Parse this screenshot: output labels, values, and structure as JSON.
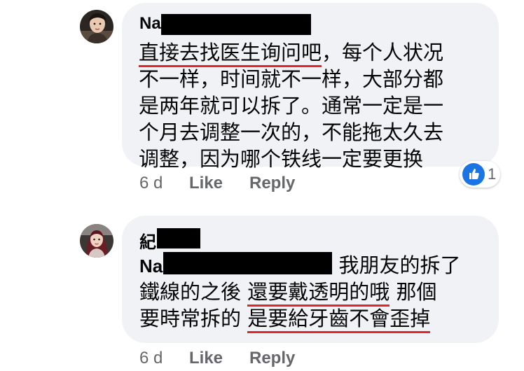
{
  "comments": [
    {
      "author_visible": "Na",
      "body_lines": [
        {
          "u": "直接去找医生询问吧",
          "rest": "，每个人状况"
        },
        "不一样，时间就不一样，大部分都",
        "是两年就可以拆了。通常一定是一",
        "个月去调整一次的，不能拖太久去",
        "调整，因为哪个铁线一定要更换"
      ],
      "time": "6 d",
      "like_label": "Like",
      "reply_label": "Reply",
      "reaction_icon": "thumbs-up-icon",
      "reaction_count": "1"
    },
    {
      "author_visible": "紀",
      "tag_visible": "Na",
      "body_line1_rest": " 我朋友的拆了",
      "line2_pre": "鐵線的之後 ",
      "line2_u": "還要戴透明的哦",
      "line2_post": " 那個",
      "line3_pre": "要時常拆的 ",
      "line3_u": "是要給牙齒不會歪掉",
      "time": "6 d",
      "like_label": "Like",
      "reply_label": "Reply"
    }
  ],
  "colors": {
    "bubble": "#f0f2f5",
    "underline": "#e0252b",
    "meta_text": "#65676b",
    "like_blue": "#1b74e4"
  }
}
